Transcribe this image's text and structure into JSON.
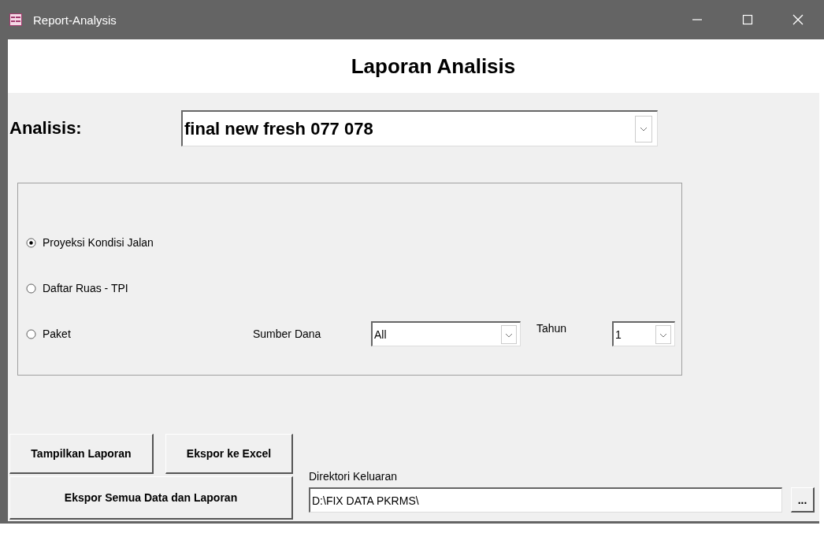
{
  "window": {
    "title": "Report-Analysis"
  },
  "header": {
    "title": "Laporan Analisis"
  },
  "analysis": {
    "label": "Analisis:",
    "value": "final new fresh 077 078"
  },
  "report_types": [
    {
      "label": "Proyeksi Kondisi Jalan",
      "selected": true
    },
    {
      "label": "Daftar Ruas - TPI",
      "selected": false
    },
    {
      "label": "Paket",
      "selected": false
    }
  ],
  "funding_source": {
    "label": "Sumber Dana",
    "value": "All"
  },
  "year": {
    "label": "Tahun",
    "value": "1"
  },
  "buttons": {
    "show_report": "Tampilkan Laporan",
    "export_excel": "Ekspor ke Excel",
    "export_all": "Ekspor Semua Data dan Laporan",
    "browse": "..."
  },
  "output_dir": {
    "label": "Direktori Keluaran",
    "value": "D:\\FIX DATA PKRMS\\"
  }
}
